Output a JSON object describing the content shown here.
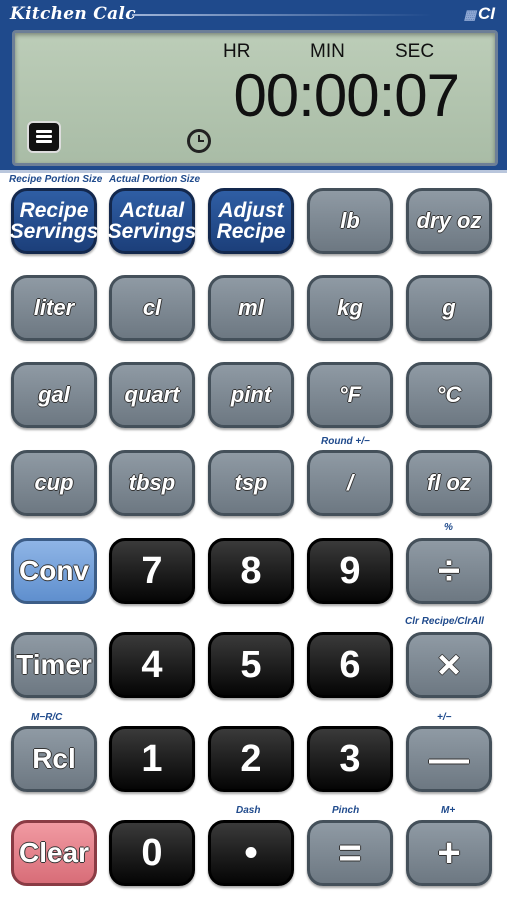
{
  "header": {
    "brand": "Kitchen Calc",
    "logo_mark": "▦",
    "logo_text": "CI"
  },
  "display": {
    "hr_label": "HR",
    "min_label": "MIN",
    "sec_label": "SEC",
    "value": "00:00:07",
    "menu_icon": "menu-icon",
    "timer_icon": "clock-icon"
  },
  "captions": {
    "recipe_portion": "Recipe Portion Size",
    "actual_portion": "Actual Portion Size",
    "round": "Round +/−",
    "percent": "%",
    "clr": "Clr Recipe/ClrAll",
    "mrc": "M−R/C",
    "plusminus": "+/−",
    "dash": "Dash",
    "pinch": "Pinch",
    "mplus": "M+"
  },
  "keys": {
    "recipe_servings": [
      "Recipe",
      "Servings"
    ],
    "actual_servings": [
      "Actual",
      "Servings"
    ],
    "adjust_recipe": [
      "Adjust",
      "Recipe"
    ],
    "lb": "lb",
    "dry_oz": "dry oz",
    "liter": "liter",
    "cl": "cl",
    "ml": "ml",
    "kg": "kg",
    "g": "g",
    "gal": "gal",
    "quart": "quart",
    "pint": "pint",
    "deg_f": "°F",
    "deg_c": "°C",
    "cup": "cup",
    "tbsp": "tbsp",
    "tsp": "tsp",
    "fraction": "/",
    "fl_oz": "fl oz",
    "conv": "Conv",
    "seven": "7",
    "eight": "8",
    "nine": "9",
    "divide": "÷",
    "timer": "Timer",
    "four": "4",
    "five": "5",
    "six": "6",
    "multiply": "×",
    "rcl": "Rcl",
    "one": "1",
    "two": "2",
    "three": "3",
    "minus": "—",
    "clear": "Clear",
    "zero": "0",
    "dot": "•",
    "equals": "=",
    "plus": "+"
  },
  "colors": {
    "frame": "#1f4a8c",
    "lcd": "#b3c5b0",
    "unit_key": "#7d8892",
    "function_key": "#1f4a8c",
    "digit_key": "#111111",
    "conv_key": "#7aa3dc",
    "clear_key": "#e48690"
  }
}
